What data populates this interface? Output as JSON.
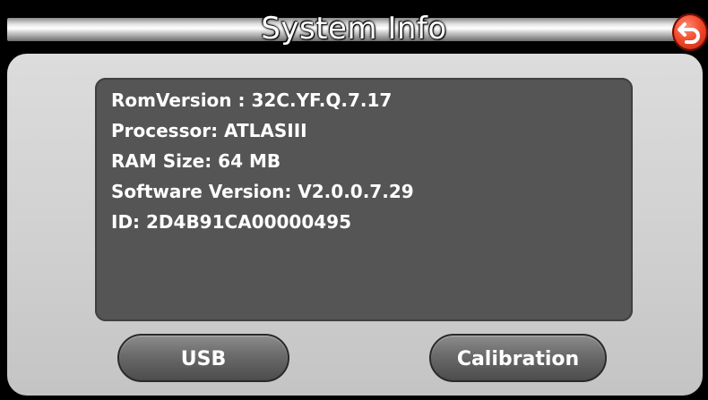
{
  "header": {
    "title": "System Info",
    "back_icon": "back-arrow-icon",
    "back_color": "#f0482b"
  },
  "info": {
    "lines": [
      "RomVersion : 32C.YF.Q.7.17",
      "Processor: ATLASIII",
      "RAM Size: 64 MB",
      "Software Version: V2.0.0.7.29",
      "ID: 2D4B91CA00000495"
    ]
  },
  "buttons": {
    "usb_label": "USB",
    "calibration_label": "Calibration"
  }
}
